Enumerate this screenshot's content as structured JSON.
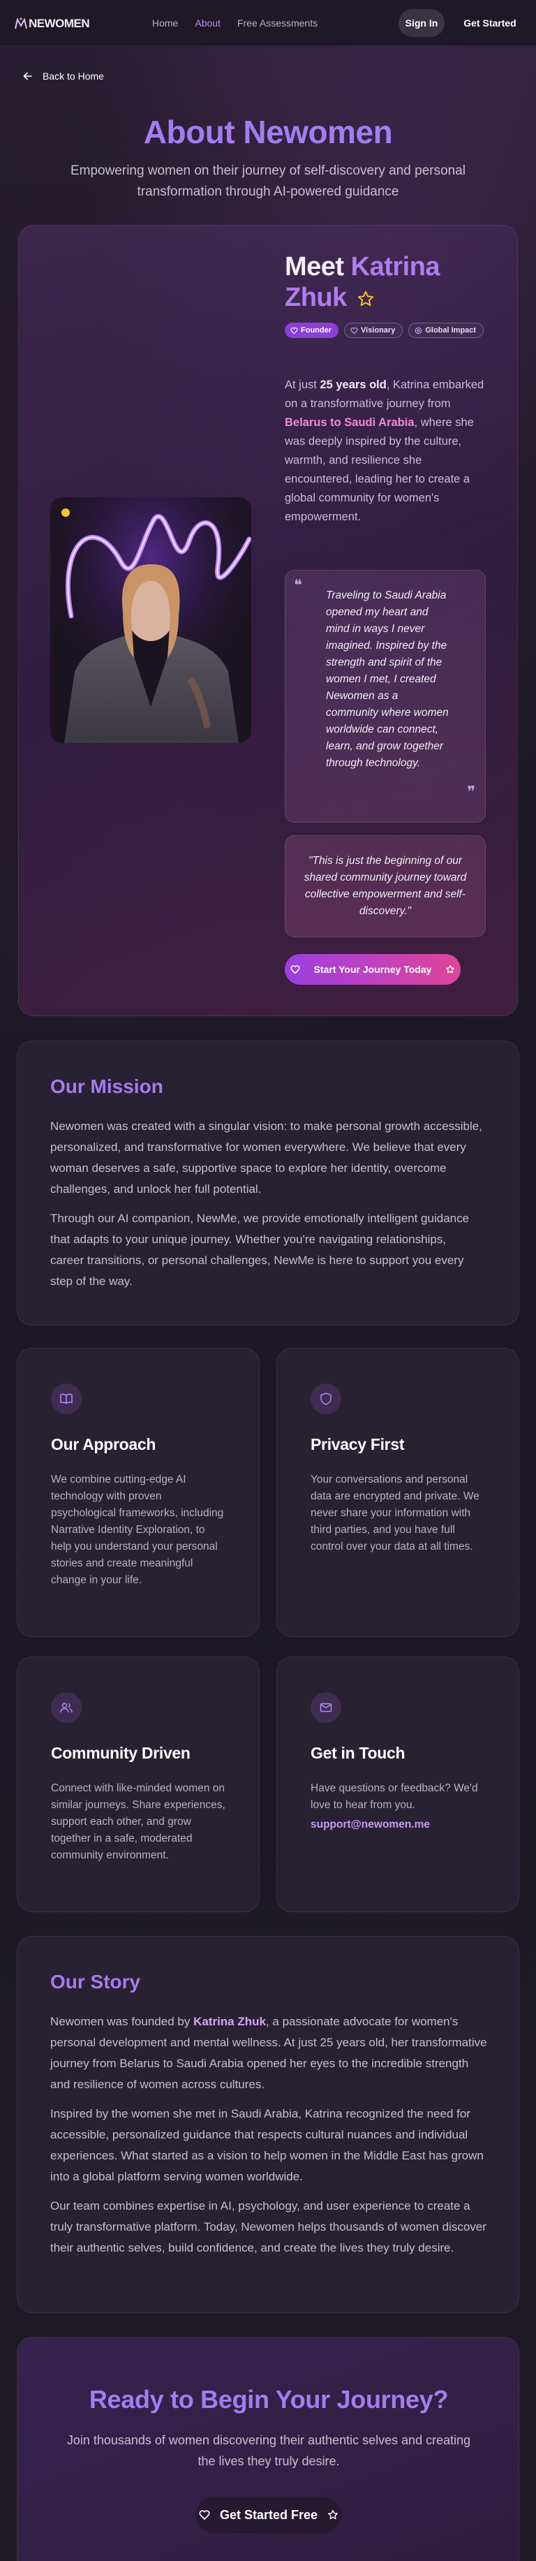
{
  "nav": {
    "logo": "NEWOMEN",
    "links": [
      "Home",
      "About",
      "Free Assessments"
    ],
    "active_link": "About",
    "signin_label": "Sign In",
    "get_started_label": "Get Started"
  },
  "back_label": "Back to Home",
  "hero": {
    "title": "About Newomen",
    "subtitle": "Empowering women on their journey of self-discovery and personal transformation through AI-powered guidance"
  },
  "founder": {
    "meet_prefix": "Meet",
    "name": "Katrina Zhuk",
    "badges": [
      "Founder",
      "Visionary",
      "Global Impact"
    ],
    "intro": {
      "p1": "At just ",
      "age": "25 years old",
      "p2": ", Katrina embarked on a transformative journey from ",
      "route": "Belarus to Saudi Arabia",
      "p3": ", where she was deeply inspired by the culture, warmth, and resilience she encountered, leading her to create a global community for women's empowerment."
    },
    "quote": "Traveling to Saudi Arabia opened my heart and mind in ways I never imagined. Inspired by the strength and spirit of the women I met, I created Newomen as a community where women worldwide can connect, learn, and grow together through technology.",
    "quote2": "\"This is just the beginning of our shared community journey toward collective empowerment and self-discovery.\"",
    "cta_label": "Start Your Journey Today"
  },
  "mission": {
    "heading": "Our Mission",
    "p1": "Newomen was created with a singular vision: to make personal growth accessible, personalized, and transformative for women everywhere. We believe that every woman deserves a safe, supportive space to explore her identity, overcome challenges, and unlock her full potential.",
    "p2": "Through our AI companion, NewMe, we provide emotionally intelligent guidance that adapts to your unique journey. Whether you're navigating relationships, career transitions, or personal challenges, NewMe is here to support you every step of the way."
  },
  "features": [
    {
      "icon": "book-icon",
      "title": "Our Approach",
      "text": "We combine cutting-edge AI technology with proven psychological frameworks, including Narrative Identity Exploration, to help you understand your personal stories and create meaningful change in your life."
    },
    {
      "icon": "shield-icon",
      "title": "Privacy First",
      "text": "Your conversations and personal data are encrypted and private. We never share your information with third parties, and you have full control over your data at all times."
    },
    {
      "icon": "users-icon",
      "title": "Community Driven",
      "text": "Connect with like-minded women on similar journeys. Share experiences, support each other, and grow together in a safe, moderated community environment."
    },
    {
      "icon": "mail-icon",
      "title": "Get in Touch",
      "text": "Have questions or feedback? We'd love to hear from you.",
      "email": "support@newomen.me"
    }
  ],
  "story": {
    "heading": "Our Story",
    "p1a": "Newomen was founded by ",
    "p1name": "Katrina Zhuk",
    "p1b": ", a passionate advocate for women's personal development and mental wellness. At just 25 years old, her transformative journey from Belarus to Saudi Arabia opened her eyes to the incredible strength and resilience of women across cultures.",
    "p2": "Inspired by the women she met in Saudi Arabia, Katrina recognized the need for accessible, personalized guidance that respects cultural nuances and individual experiences. What started as a vision to help women in the Middle East has grown into a global platform serving women worldwide.",
    "p3": "Our team combines expertise in AI, psychology, and user experience to create a truly transformative platform. Today, Newomen helps thousands of women discover their authentic selves, build confidence, and create the lives they truly desire."
  },
  "cta": {
    "title": "Ready to Begin Your Journey?",
    "text": "Join thousands of women discovering their authentic selves and creating the lives they truly desire.",
    "button": "Get Started Free"
  }
}
